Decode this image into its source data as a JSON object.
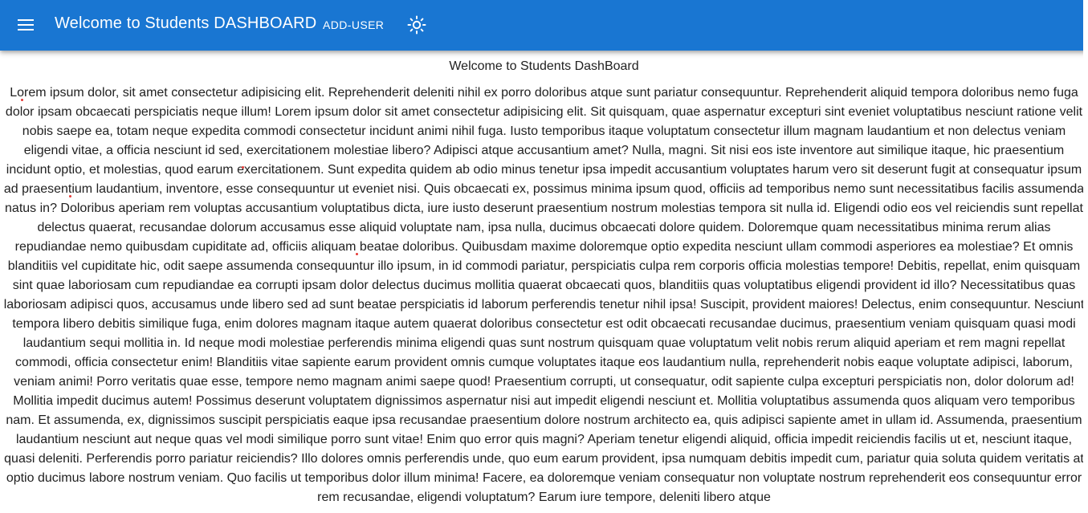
{
  "appbar": {
    "menu_icon": "hamburger-menu-icon",
    "title": "Welcome to Students DASHBOARD",
    "nav_link": "ADD-USER",
    "theme_icon": "sun-icon",
    "background_color": "#1976d2"
  },
  "main": {
    "heading": "Welcome to Students DashBoard",
    "paragraph": "Lorem ipsum dolor, sit amet consectetur adipisicing elit. Reprehenderit deleniti nihil ex porro doloribus atque sunt pariatur consequuntur. Reprehenderit aliquid tempora doloribus nemo fuga dolor ipsam obcaecati perspiciatis neque illum! Lorem ipsum dolor sit amet consectetur adipisicing elit. Sit quisquam, quae aspernatur excepturi sint eveniet voluptatibus nesciunt ratione velit nobis saepe ea, totam neque expedita commodi consectetur incidunt animi nihil fuga. Iusto temporibus itaque voluptatum consectetur illum magnam laudantium et non delectus veniam eligendi vitae, a officia nesciunt id sed, exercitationem molestiae libero? Adipisci atque accusantium amet? Nulla, magni. Sit nisi eos iste inventore aut similique itaque, hic praesentium incidunt optio, et molestias, quod earum exercitationem. Sunt expedita quidem ab odio minus tenetur ipsa impedit accusantium voluptates harum vero sit deserunt fugit at consequatur ipsum ad praesentium laudantium, inventore, esse consequuntur ut eveniet nisi. Quis obcaecati ex, possimus minima ipsum quod, officiis ad temporibus nemo sunt necessitatibus facilis assumenda natus in? Doloribus aperiam rem voluptas accusantium voluptatibus dicta, iure iusto deserunt praesentium nostrum molestias tempora sit nulla id. Eligendi odio eos vel reiciendis sunt repellat delectus quaerat, recusandae dolorum accusamus esse aliquid voluptate nam, ipsa nulla, ducimus obcaecati dolore quidem. Doloremque quam necessitatibus minima rerum alias repudiandae nemo quibusdam cupiditate ad, officiis aliquam beatae doloribus. Quibusdam maxime doloremque optio expedita nesciunt ullam commodi asperiores ea molestiae? Et omnis blanditiis vel cupiditate hic, odit saepe assumenda consequuntur illo ipsum, in id commodi pariatur, perspiciatis culpa rem corporis officia molestias tempore! Debitis, repellat, enim quisquam sint quae laboriosam cum repudiandae ea corrupti ipsam dolor delectus ducimus mollitia quaerat obcaecati quos, blanditiis quas voluptatibus eligendi provident id illo? Necessitatibus quas laboriosam adipisci quos, accusamus unde libero sed ad sunt beatae perspiciatis id laborum perferendis tenetur nihil ipsa! Suscipit, provident maiores! Delectus, enim consequuntur. Nesciunt tempora libero debitis similique fuga, enim dolores magnam itaque autem quaerat doloribus consectetur est odit obcaecati recusandae ducimus, praesentium veniam quisquam quasi modi laudantium sequi mollitia in. Id neque modi molestiae perferendis minima eligendi quas sunt nostrum quisquam quae voluptatum velit nobis rerum aliquid aperiam et rem magni repellat commodi, officia consectetur enim! Blanditiis vitae sapiente earum provident omnis cumque voluptates itaque eos laudantium nulla, reprehenderit nobis eaque voluptate adipisci, laborum, veniam animi! Porro veritatis quae esse, tempore nemo magnam animi saepe quod! Praesentium corrupti, ut consequatur, odit sapiente culpa excepturi perspiciatis non, dolor dolorum ad! Mollitia impedit ducimus autem! Possimus deserunt voluptatem dignissimos aspernatur nisi aut impedit eligendi nesciunt et. Mollitia voluptatibus assumenda quos aliquam vero temporibus nam. Et assumenda, ex, dignissimos suscipit perspiciatis eaque ipsa recusandae praesentium dolore nostrum architecto ea, quis adipisci sapiente amet in ullam id. Assumenda, praesentium laudantium nesciunt aut neque quas vel modi similique porro sunt vitae! Enim quo error quis magni? Aperiam tenetur eligendi aliquid, officia impedit reiciendis facilis ut et, nesciunt itaque, quasi deleniti. Perferendis porro pariatur reiciendis? Illo dolores omnis perferendis unde, quo eum earum provident, ipsa numquam debitis impedit cum, pariatur quia soluta quidem veritatis at optio ducimus labore nostrum veniam. Quo facilis ut temporibus dolor illum minima! Facere, ea doloremque veniam consequatur non voluptate nostrum reprehenderit eos consequuntur error rem recusandae, eligendi voluptatum? Earum iure tempore, deleniti libero atque"
  }
}
